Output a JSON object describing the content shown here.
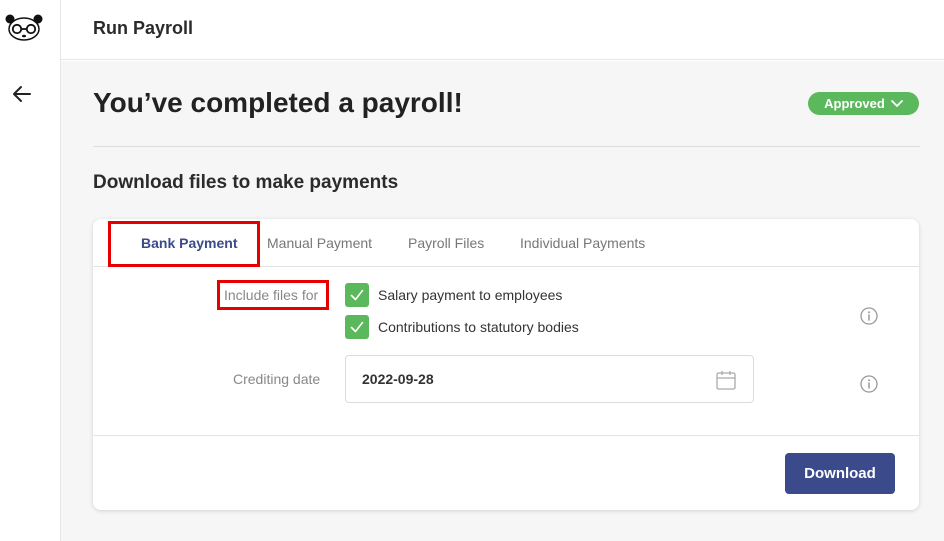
{
  "header": {
    "title": "Run Payroll"
  },
  "page": {
    "heading": "You’ve completed a payroll!",
    "status": "Approved",
    "subheading": "Download files to make payments"
  },
  "tabs": [
    {
      "label": "Bank Payment",
      "active": true
    },
    {
      "label": "Manual Payment",
      "active": false
    },
    {
      "label": "Payroll Files",
      "active": false
    },
    {
      "label": "Individual Payments",
      "active": false
    }
  ],
  "form": {
    "include_label": "Include files for",
    "options": [
      {
        "label": "Salary payment to employees",
        "checked": true
      },
      {
        "label": "Contributions to statutory bodies",
        "checked": true
      }
    ],
    "date_label": "Crediting date",
    "date_value": "2022-09-28"
  },
  "actions": {
    "download": "Download"
  },
  "colors": {
    "accent": "#3b4a8a",
    "success": "#5cb85c",
    "highlight": "#e60000"
  },
  "icons": [
    "panda-logo-icon",
    "back-arrow-icon",
    "chevron-down-icon",
    "check-icon",
    "info-icon",
    "calendar-icon"
  ]
}
